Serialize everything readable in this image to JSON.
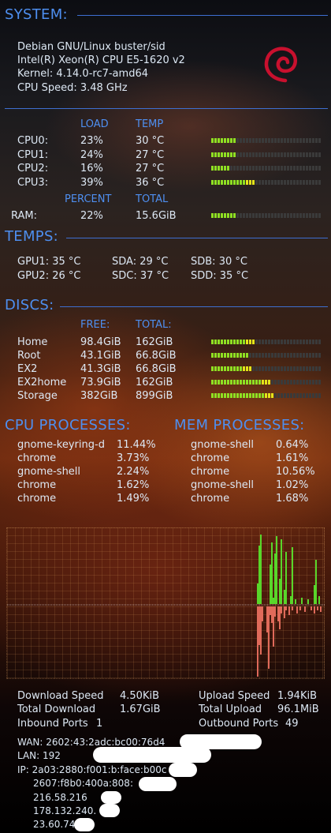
{
  "system": {
    "header": "SYSTEM:",
    "os": "Debian GNU/Linux buster/sid",
    "cpu": "Intel(R) Xeon(R) CPU E5-1620 v2",
    "kernel": "Kernel:  4.14.0-rc7-amd64",
    "speed": "CPU Speed: 3.48  GHz"
  },
  "cpu_table": {
    "load_header": "LOAD",
    "temp_header": "TEMP",
    "rows": [
      {
        "name": "CPU0:",
        "load": "23%",
        "temp": "30 °C",
        "fill": 0.23
      },
      {
        "name": "CPU1:",
        "load": "24%",
        "temp": "27 °C",
        "fill": 0.24
      },
      {
        "name": "CPU2:",
        "load": "16%",
        "temp": "27 °C",
        "fill": 0.16
      },
      {
        "name": "CPU3:",
        "load": "39%",
        "temp": "36 °C",
        "fill": 0.39
      }
    ]
  },
  "ram": {
    "percent_header": "PERCENT",
    "total_header": "TOTAL",
    "label": "RAM:",
    "percent": "22%",
    "total": "15.6GiB",
    "fill": 0.22
  },
  "temps": {
    "header": "TEMPS:",
    "gpu1": "GPU1:  35 °C",
    "gpu2": "GPU2:  26 °C",
    "sda": "SDA:  29 °C",
    "sdc": "SDC:  37 °C",
    "sdb": "SDB:  30 °C",
    "sdd": "SDD:  35 °C"
  },
  "discs": {
    "header": "DISCS:",
    "free_header": "FREE:",
    "total_header": "TOTAL:",
    "rows": [
      {
        "name": "Home",
        "free": "98.4GiB",
        "total": "162GiB",
        "fill": 0.39
      },
      {
        "name": "Root",
        "free": "43.1GiB",
        "total": "66.8GiB",
        "fill": 0.35
      },
      {
        "name": "EX2",
        "free": "41.3GiB",
        "total": "66.8GiB",
        "fill": 0.38
      },
      {
        "name": "EX2home",
        "free": "73.9GiB",
        "total": "162GiB",
        "fill": 0.54
      },
      {
        "name": "Storage",
        "free": "382GiB",
        "total": "899GiB",
        "fill": 0.58
      }
    ]
  },
  "cpu_processes": {
    "header": "CPU PROCESSES:",
    "rows": [
      {
        "name": "gnome-keyring-d",
        "value": "11.44%"
      },
      {
        "name": "chrome",
        "value": "3.73%"
      },
      {
        "name": "gnome-shell",
        "value": "2.24%"
      },
      {
        "name": "chrome",
        "value": "1.62%"
      },
      {
        "name": "chrome",
        "value": "1.49%"
      }
    ]
  },
  "mem_processes": {
    "header": "MEM PROCESSES:",
    "rows": [
      {
        "name": "gnome-shell",
        "value": "0.64%"
      },
      {
        "name": "chrome",
        "value": "1.61%"
      },
      {
        "name": "chrome",
        "value": "10.56%"
      },
      {
        "name": "gnome-shell",
        "value": "1.02%"
      },
      {
        "name": "chrome",
        "value": "1.68%"
      }
    ]
  },
  "network": {
    "download_speed_label": "Download Speed",
    "download_speed": "4.50KiB",
    "total_download_label": "Total Download",
    "total_download": "1.67GiB",
    "inbound_label": "Inbound Ports",
    "inbound": "1",
    "upload_speed_label": "Upload Speed",
    "upload_speed": "1.94KiB",
    "total_upload_label": "Total Upload",
    "total_upload": "96.1MiB",
    "outbound_label": "Outbound Ports",
    "outbound": "49",
    "wan": "WAN:   2602:43:2adc:bc00:76d4",
    "lan": "LAN:    192",
    "ip_lines": [
      "IP: 2a03:2880:f001:b:face:b00c",
      "2607:f8b0:400a:808:",
      "216.58.216",
      "178.132.240.",
      "23.60.74"
    ]
  },
  "colors": {
    "accent": "#4e8ff0",
    "bar_on": "#8fe023",
    "bar_hi": "#e4e41a",
    "graph_down": "#59d62a",
    "graph_up": "#e06a5a"
  },
  "icons": {
    "logo": "debian-swirl-icon"
  }
}
